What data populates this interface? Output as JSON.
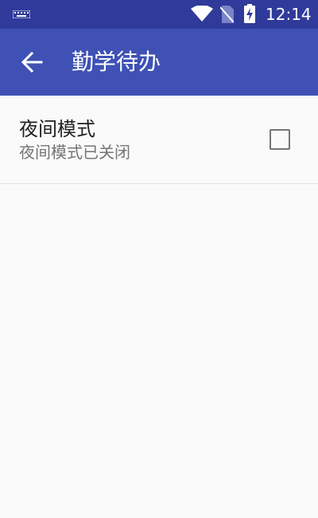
{
  "status_bar": {
    "time": "12:14",
    "icons": [
      "keyboard-icon",
      "wifi-icon",
      "no-sim-icon",
      "battery-charging-icon"
    ]
  },
  "app_bar": {
    "title": "勤学待办",
    "back_icon": "arrow-back-icon",
    "color": "#3f51b5"
  },
  "settings": {
    "night_mode": {
      "title": "夜间模式",
      "summary": "夜间模式已关闭",
      "checked": false
    }
  },
  "colors": {
    "status_bar": "#2f3a9a",
    "primary": "#3f51b5",
    "background": "#fafafa",
    "checkbox_border": "#757575"
  }
}
